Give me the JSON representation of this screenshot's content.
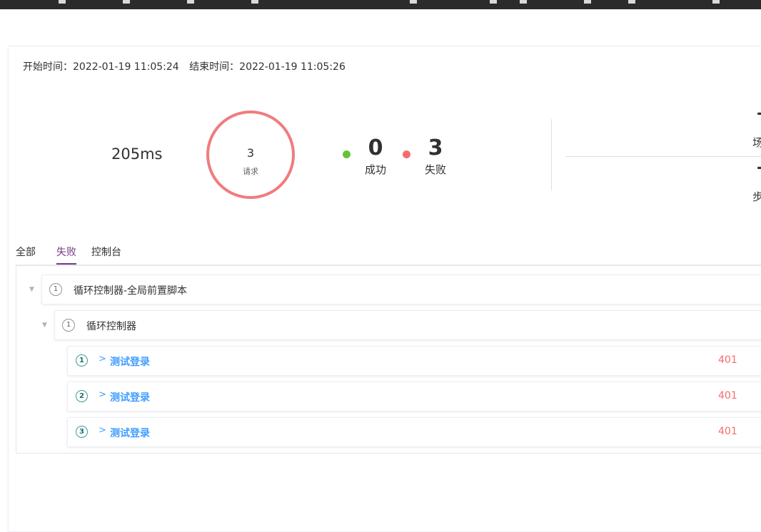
{
  "header": {
    "start_label": "开始时间：",
    "start_value": "2022-01-19 11:05:24",
    "end_label": "结束时间：",
    "end_value": "2022-01-19 11:05:26"
  },
  "summary": {
    "duration": "205ms",
    "request_count": "3",
    "request_label": "请求",
    "success_count": "0",
    "success_label": "成功",
    "fail_count": "3",
    "fail_label": "失败",
    "scenario_label": "场",
    "step_label": "步",
    "scenario_value": "-",
    "step_value": "-"
  },
  "colors": {
    "ring": "#f07c7e",
    "success_dot": "#67c23a",
    "fail_dot": "#f56c6c",
    "active_tab": "#783887",
    "link": "#409eff",
    "status_error": "#f56c6c"
  },
  "tabs": [
    {
      "label": "全部"
    },
    {
      "label": "失败"
    },
    {
      "label": "控制台"
    }
  ],
  "active_tab": "失败",
  "tree": {
    "root": {
      "index": "1",
      "title": "循环控制器-全局前置脚本"
    },
    "child": {
      "index": "1",
      "title": "循环控制器"
    },
    "requests": [
      {
        "index": "1",
        "name": "测试登录",
        "status": "401"
      },
      {
        "index": "2",
        "name": "测试登录",
        "status": "401"
      },
      {
        "index": "3",
        "name": "测试登录",
        "status": "401"
      }
    ]
  }
}
